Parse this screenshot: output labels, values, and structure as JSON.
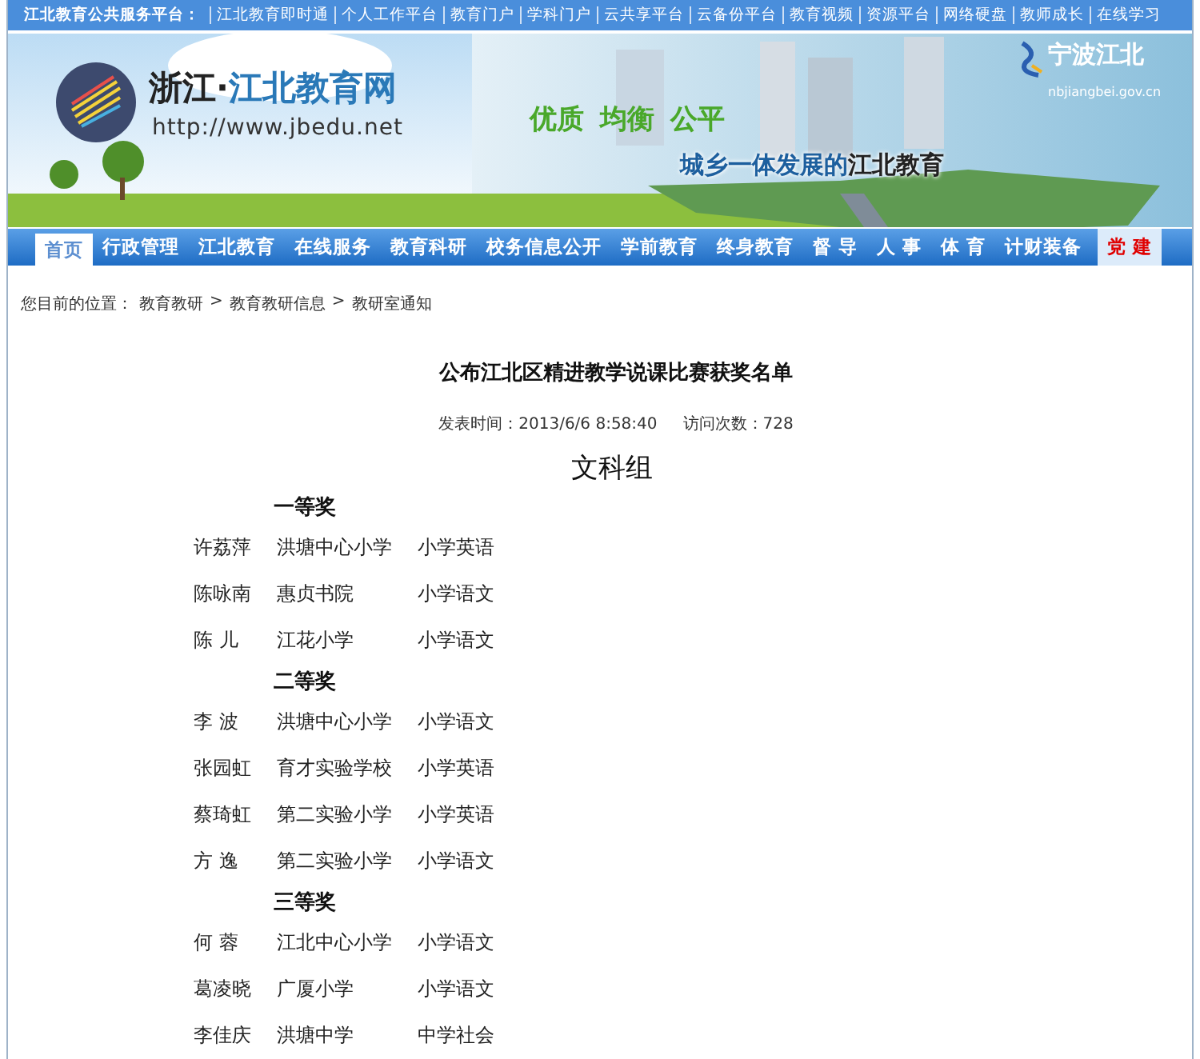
{
  "top_bar": {
    "label": "江北教育公共服务平台：",
    "links": [
      "江北教育即时通",
      "个人工作平台",
      "教育门户",
      "学科门户",
      "云共享平台",
      "云备份平台",
      "教育视频",
      "资源平台",
      "网络硬盘",
      "教师成长",
      "在线学习"
    ]
  },
  "header": {
    "site_region": "浙江",
    "site_dot": "·",
    "site_name": "江北教育网",
    "url": "http://www.jbedu.net",
    "slogan_words": [
      "优质",
      "均衡",
      "公平"
    ],
    "slogan_line": "城乡一体发展的**江北教育**",
    "badge_title": "宁波江北",
    "badge_url": "nbjiangbei.gov.cn"
  },
  "nav": {
    "items": [
      {
        "label": "首页",
        "selected": true,
        "emphasized": false
      },
      {
        "label": "行政管理",
        "selected": false,
        "emphasized": false
      },
      {
        "label": "江北教育",
        "selected": false,
        "emphasized": false
      },
      {
        "label": "在线服务",
        "selected": false,
        "emphasized": false
      },
      {
        "label": "教育科研",
        "selected": false,
        "emphasized": false
      },
      {
        "label": "校务信息公开",
        "selected": false,
        "emphasized": false
      },
      {
        "label": "学前教育",
        "selected": false,
        "emphasized": false
      },
      {
        "label": "终身教育",
        "selected": false,
        "emphasized": false
      },
      {
        "label": "督 导",
        "selected": false,
        "emphasized": false
      },
      {
        "label": "人 事",
        "selected": false,
        "emphasized": false
      },
      {
        "label": "体 育",
        "selected": false,
        "emphasized": false
      },
      {
        "label": "计财装备",
        "selected": false,
        "emphasized": false
      },
      {
        "label": "党 建",
        "selected": false,
        "emphasized": true
      }
    ]
  },
  "breadcrumb": {
    "label": "您目前的位置：",
    "separator": ">",
    "items": [
      "教育教研",
      "教育教研信息",
      "教研室通知"
    ]
  },
  "article": {
    "title": "公布江北区精进教学说课比赛获奖名单",
    "published": "发表时间：2013/6/6 8:58:40",
    "visits": "访问次数：728",
    "group": "文科组",
    "prizes": [
      {
        "title": "一等奖",
        "winners": [
          {
            "name": "许荔萍",
            "school": "洪塘中心小学",
            "subject": "小学英语"
          },
          {
            "name": "陈咏南",
            "school": "惠贞书院",
            "subject": "小学语文"
          },
          {
            "name": "陈 儿",
            "school": "江花小学",
            "subject": "小学语文"
          }
        ]
      },
      {
        "title": "二等奖",
        "winners": [
          {
            "name": "李 波",
            "school": "洪塘中心小学",
            "subject": "小学语文"
          },
          {
            "name": "张园虹",
            "school": "育才实验学校",
            "subject": "小学英语"
          },
          {
            "name": "蔡琦虹",
            "school": "第二实验小学",
            "subject": "小学英语"
          },
          {
            "name": "方 逸",
            "school": "第二实验小学",
            "subject": "小学语文"
          }
        ]
      },
      {
        "title": "三等奖",
        "winners": [
          {
            "name": "何 蓉",
            "school": "江北中心小学",
            "subject": "小学语文"
          },
          {
            "name": "葛凌晓",
            "school": "广厦小学",
            "subject": "小学语文"
          },
          {
            "name": "李佳庆",
            "school": "洪塘中学",
            "subject": "中学社会"
          }
        ]
      }
    ]
  }
}
